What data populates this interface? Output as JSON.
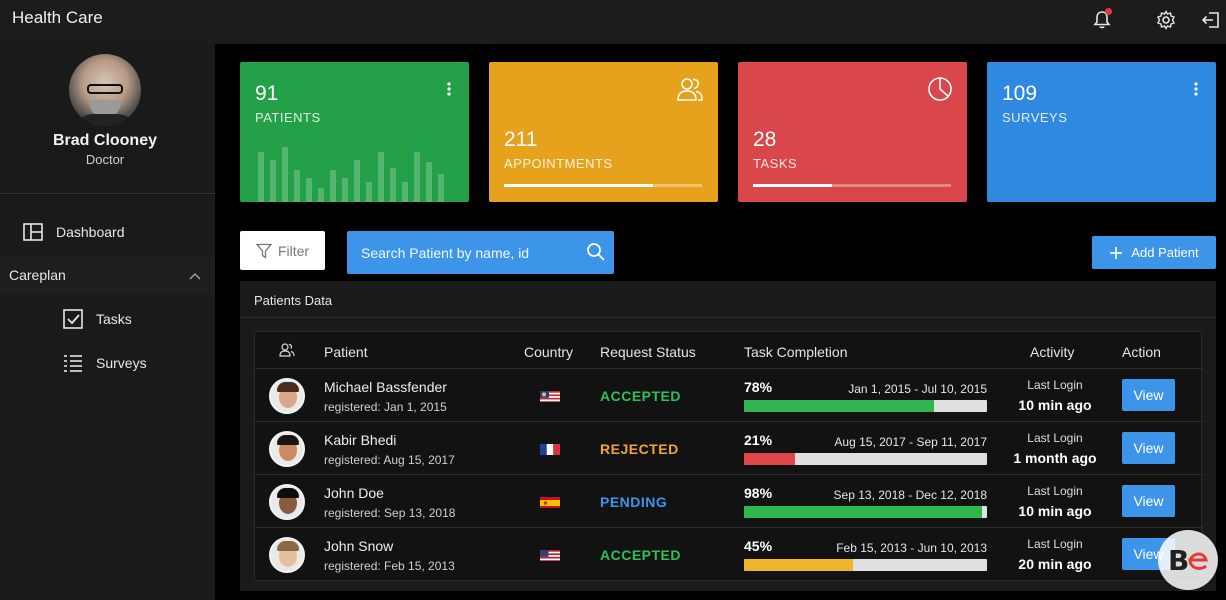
{
  "header": {
    "title": "Health Care",
    "icons": [
      "bell-icon",
      "gear-icon",
      "logout-icon"
    ],
    "notification_dot_color": "#e53935"
  },
  "sidebar": {
    "user": {
      "name": "Brad Clooney",
      "role": "Doctor"
    },
    "items": [
      {
        "label": "Dashboard",
        "icon": "dashboard-icon"
      },
      {
        "label": "Careplan",
        "icon": "chevron-up-icon"
      },
      {
        "label": "Tasks",
        "icon": "checkbox-icon"
      },
      {
        "label": "Surveys",
        "icon": "list-icon"
      }
    ]
  },
  "cards": [
    {
      "value": "91",
      "label": "PATIENTS",
      "color": "#24a148",
      "icon": "kebab-icon"
    },
    {
      "value": "211",
      "label": "APPOINTMENTS",
      "color": "#e7a21d",
      "icon": "users-icon",
      "progress": 0.75
    },
    {
      "value": "28",
      "label": "TASKS",
      "color": "#d9474b",
      "icon": "pie-chart-icon",
      "progress": 0.4
    },
    {
      "value": "109",
      "label": "SURVEYS",
      "color": "#2f89e0",
      "icon": "kebab-icon"
    }
  ],
  "toolbar": {
    "filter_label": "Filter",
    "search_placeholder": "Search Patient by name, id",
    "add_label": "Add Patient"
  },
  "table": {
    "title": "Patients Data",
    "headers": [
      "Patient",
      "Country",
      "Request Status",
      "Task Completion",
      "Activity",
      "Action"
    ],
    "rows": [
      {
        "name": "Michael Bassfender",
        "registered": "registered: Jan 1, 2015",
        "country": "malaysia",
        "status": "ACCEPTED",
        "status_color": "#2fc05a",
        "pct": "78%",
        "completion": 0.78,
        "range": "Jan 1, 2015 - Jul 10, 2015",
        "bar_color": "#2fb650",
        "activity_label": "Last Login",
        "activity_value": "10 min ago",
        "action": "View"
      },
      {
        "name": "Kabir Bhedi",
        "registered": "registered: Aug 15, 2017",
        "country": "france",
        "status": "REJECTED",
        "status_color": "#f1a43a",
        "pct": "21%",
        "completion": 0.21,
        "range": "Aug 15, 2017 - Sep 11, 2017",
        "bar_color": "#e0474c",
        "activity_label": "Last Login",
        "activity_value": "1 month ago",
        "action": "View"
      },
      {
        "name": "John Doe",
        "registered": "registered: Sep 13, 2018",
        "country": "spain",
        "status": "PENDING",
        "status_color": "#3d95ea",
        "pct": "98%",
        "completion": 0.98,
        "range": "Sep 13, 2018 - Dec 12, 2018",
        "bar_color": "#2fb650",
        "activity_label": "Last Login",
        "activity_value": "10 min ago",
        "action": "View"
      },
      {
        "name": "John Snow",
        "registered": "registered: Feb 15, 2013",
        "country": "usa",
        "status": "ACCEPTED",
        "status_color": "#2fc05a",
        "pct": "45%",
        "completion": 0.45,
        "range": "Feb 15, 2013 - Jun 10, 2013",
        "bar_color": "#f0b52b",
        "activity_label": "Last Login",
        "activity_value": "20 min ago",
        "action": "View"
      }
    ]
  },
  "watermark": "Be"
}
